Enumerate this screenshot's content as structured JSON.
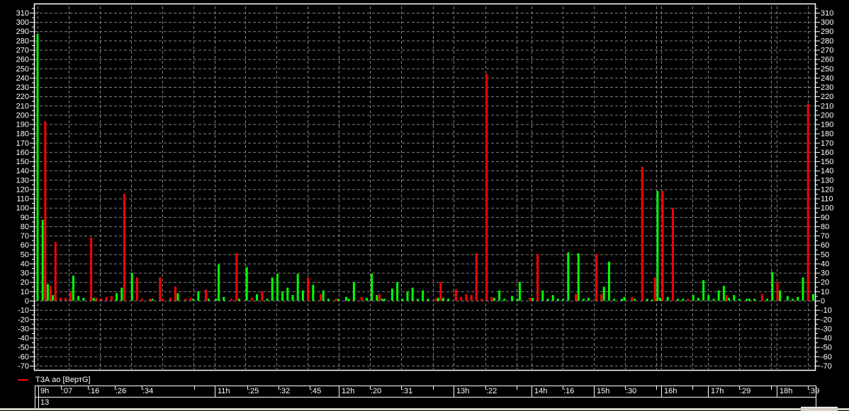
{
  "chart_data": {
    "type": "bar",
    "title": "",
    "xlabel": "",
    "ylabel": "",
    "ylim": [
      -70,
      310
    ],
    "ytick_step": 10,
    "grid": true,
    "legend": {
      "label": "Т3А ао [ВертG]",
      "color": "#ff0000",
      "placement": "bottom-left"
    },
    "colors": {
      "up": "#00ff00",
      "down": "#ff0000",
      "background": "#000000",
      "grid": "#808080"
    },
    "yticks": [
      310,
      300,
      290,
      280,
      270,
      260,
      250,
      240,
      230,
      220,
      210,
      200,
      190,
      180,
      170,
      160,
      150,
      140,
      130,
      120,
      110,
      100,
      90,
      80,
      70,
      60,
      50,
      40,
      30,
      20,
      10,
      0,
      -10,
      -20,
      -30,
      -40,
      -50,
      -60,
      -70
    ],
    "x_slots": 305,
    "series": [
      {
        "name": "up",
        "color": "green",
        "points": [
          [
            0,
            287
          ],
          [
            2,
            87
          ],
          [
            4,
            18
          ],
          [
            6,
            6
          ],
          [
            14,
            27
          ],
          [
            16,
            5
          ],
          [
            18,
            3
          ],
          [
            22,
            3
          ],
          [
            31,
            8
          ],
          [
            33,
            14
          ],
          [
            37,
            30
          ],
          [
            45,
            2
          ],
          [
            55,
            8
          ],
          [
            61,
            2
          ],
          [
            63,
            10
          ],
          [
            67,
            2
          ],
          [
            70,
            2
          ],
          [
            71,
            39
          ],
          [
            73,
            4
          ],
          [
            79,
            2
          ],
          [
            82,
            36
          ],
          [
            86,
            7
          ],
          [
            90,
            2
          ],
          [
            92,
            25
          ],
          [
            94,
            29
          ],
          [
            96,
            10
          ],
          [
            98,
            14
          ],
          [
            100,
            6
          ],
          [
            102,
            29
          ],
          [
            104,
            11
          ],
          [
            108,
            17
          ],
          [
            112,
            11
          ],
          [
            114,
            2
          ],
          [
            118,
            2
          ],
          [
            121,
            4
          ],
          [
            122,
            2
          ],
          [
            124,
            20
          ],
          [
            129,
            3
          ],
          [
            131,
            29
          ],
          [
            133,
            6
          ],
          [
            135,
            2
          ],
          [
            136,
            2
          ],
          [
            139,
            13
          ],
          [
            141,
            20
          ],
          [
            143,
            2
          ],
          [
            145,
            10
          ],
          [
            147,
            14
          ],
          [
            149,
            2
          ],
          [
            151,
            11
          ],
          [
            153,
            2
          ],
          [
            157,
            3
          ],
          [
            159,
            3
          ],
          [
            161,
            2
          ],
          [
            179,
            3
          ],
          [
            181,
            11
          ],
          [
            183,
            2
          ],
          [
            186,
            5
          ],
          [
            188,
            2
          ],
          [
            189,
            20
          ],
          [
            194,
            3
          ],
          [
            198,
            11
          ],
          [
            200,
            2
          ],
          [
            202,
            6
          ],
          [
            204,
            2
          ],
          [
            206,
            2
          ],
          [
            208,
            52
          ],
          [
            212,
            51
          ],
          [
            214,
            2
          ],
          [
            216,
            3
          ],
          [
            222,
            15
          ],
          [
            224,
            42
          ],
          [
            226,
            2
          ],
          [
            229,
            2
          ],
          [
            230,
            4
          ],
          [
            234,
            2
          ],
          [
            239,
            2
          ],
          [
            241,
            1
          ],
          [
            243,
            118
          ],
          [
            244,
            3
          ],
          [
            247,
            4
          ],
          [
            251,
            2
          ],
          [
            253,
            2
          ],
          [
            257,
            6
          ],
          [
            259,
            3
          ],
          [
            261,
            22
          ],
          [
            263,
            6
          ],
          [
            265,
            2
          ],
          [
            267,
            11
          ],
          [
            269,
            16
          ],
          [
            271,
            3
          ],
          [
            273,
            6
          ],
          [
            275,
            2
          ],
          [
            278,
            2
          ],
          [
            279,
            2
          ],
          [
            281,
            2
          ],
          [
            286,
            2
          ],
          [
            288,
            31
          ],
          [
            291,
            11
          ],
          [
            294,
            5
          ],
          [
            296,
            2
          ],
          [
            298,
            4
          ],
          [
            300,
            25
          ],
          [
            304,
            7
          ]
        ]
      },
      {
        "name": "down",
        "color": "red",
        "points": [
          [
            3,
            193
          ],
          [
            5,
            16
          ],
          [
            7,
            63
          ],
          [
            9,
            3
          ],
          [
            11,
            3
          ],
          [
            13,
            9
          ],
          [
            21,
            68
          ],
          [
            23,
            3
          ],
          [
            25,
            2
          ],
          [
            27,
            4
          ],
          [
            29,
            5
          ],
          [
            34,
            115
          ],
          [
            39,
            25
          ],
          [
            41,
            2
          ],
          [
            44,
            2
          ],
          [
            48,
            25
          ],
          [
            49,
            2
          ],
          [
            52,
            3
          ],
          [
            54,
            15
          ],
          [
            58,
            2
          ],
          [
            60,
            3
          ],
          [
            66,
            12
          ],
          [
            76,
            2
          ],
          [
            78,
            51
          ],
          [
            84,
            3
          ],
          [
            88,
            10
          ],
          [
            106,
            25
          ],
          [
            111,
            7
          ],
          [
            117,
            2
          ],
          [
            127,
            4
          ],
          [
            134,
            7
          ],
          [
            156,
            2
          ],
          [
            158,
            20
          ],
          [
            164,
            12
          ],
          [
            166,
            4
          ],
          [
            168,
            7
          ],
          [
            170,
            6
          ],
          [
            172,
            51
          ],
          [
            174,
            2
          ],
          [
            176,
            244
          ],
          [
            178,
            4
          ],
          [
            193,
            3
          ],
          [
            196,
            50
          ],
          [
            211,
            7
          ],
          [
            219,
            50
          ],
          [
            221,
            7
          ],
          [
            233,
            4
          ],
          [
            237,
            144
          ],
          [
            242,
            25
          ],
          [
            245,
            118
          ],
          [
            249,
            100
          ],
          [
            255,
            2
          ],
          [
            270,
            6
          ],
          [
            284,
            7
          ],
          [
            290,
            20
          ],
          [
            302,
            212
          ]
        ]
      }
    ],
    "time_axis": {
      "labels": [
        ":07",
        ":16",
        ":26",
        ":34",
        ":25",
        ":32",
        ":45",
        ":20",
        ":31",
        ":22",
        ":16",
        ":30",
        ":29",
        ":39"
      ],
      "hours": [
        "9h",
        "11h",
        "12h",
        "13h",
        "14h",
        "15h",
        "16h",
        "17h",
        "18h"
      ],
      "day": "13"
    }
  }
}
